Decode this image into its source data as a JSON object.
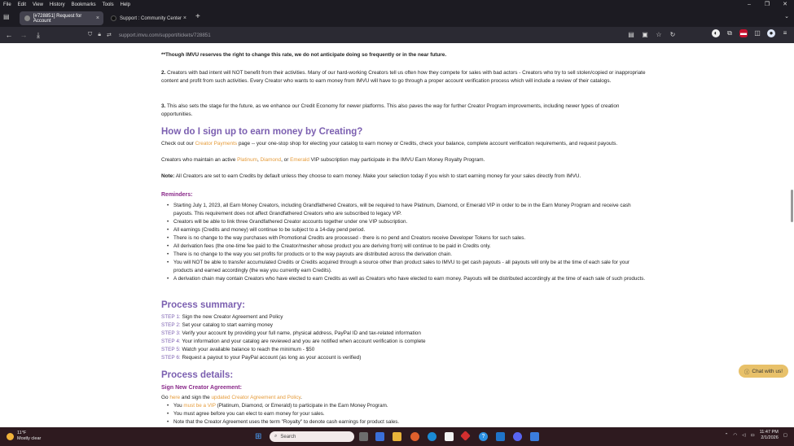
{
  "menubar": {
    "items": [
      "File",
      "Edit",
      "View",
      "History",
      "Bookmarks",
      "Tools",
      "Help"
    ]
  },
  "window_controls": {
    "minimize": "–",
    "maximize": "❐",
    "close": "✕"
  },
  "tabs": [
    {
      "label": "[#728851] Request for Account",
      "close": "×"
    },
    {
      "label": "Support : Community Center",
      "close": "×"
    }
  ],
  "new_tab": "+",
  "tab_overflow": "⌄",
  "navbar": {
    "back": "←",
    "forward": "→",
    "downloads": "⤓",
    "url": "support.imvu.com/support/tickets/728851"
  },
  "content": {
    "note_rate": "**Though IMVU reserves the right to change this rate, we do not anticipate doing so frequently or in the near future.",
    "point2_num": "2.",
    "point2_text": " Creators with bad intent will NOT benefit from their activities. Many of our hard-working Creators tell us often how they compete for sales with bad actors - Creators who try to sell stolen/copied or inappropriate content and profit from such activities. Every Creator who wants to earn money from IMVU will have to go through a proper account verification process which will include a review of their catalogs.",
    "point3_num": "3.",
    "point3_text": " This also sets the stage for the future, as we enhance our Credit Economy for newer platforms. This also paves the way for further Creator Program improvements, including newer types of creation opportunities.",
    "signup_heading": "How do I sign up to earn money by Creating?",
    "checkout_pre": "Check out our ",
    "checkout_link": "Creator Payments",
    "checkout_post": " page -- your one-stop shop for electing your catalog to earn money or Credits, check your balance, complete account verification requirements, and request payouts.",
    "vip_pre": "Creators who maintain an active ",
    "vip_platinum": "Platinum",
    "vip_sep1": ", ",
    "vip_diamond": "Diamond",
    "vip_sep2": ", or ",
    "vip_emerald": "Emerald",
    "vip_post": " VIP subscription may participate in the IMVU Earn Money Royalty Program.",
    "note_label": "Note:",
    "note_text": " All Creators are set to earn Credits by default unless they choose to earn money. Make your selection today if you wish to start earning money for your sales directly from IMVU.",
    "reminders_heading": "Reminders:",
    "reminders": [
      "Starting July 1, 2023, all Earn Money Creators, including Grandfathered Creators, will be required to have Platinum, Diamond, or Emerald VIP in order to be in the Earn Money Program and receive cash payouts. This requirement does not affect Grandfathered Creators who are subscribed to legacy VIP.",
      "Creators will be able to link three Grandfathered Creator accounts together under one VIP subscription.",
      "All earnings (Credits and money) will continue to be subject to a 14-day pend period.",
      "There is no change to the way purchases with Promotional Credits are processed - there is no pend and Creators receive Developer Tokens for such sales.",
      "All derivation fees (the one-time fee paid to the Creator/mesher whose product you are deriving from) will continue to be paid in Credits only.",
      "There is no change to the way you set profits for products or to the way payouts are distributed across the derivation chain.",
      "You will NOT be able to transfer accumulated Credits or Credits acquired through a source other than product sales to IMVU to get cash payouts - all payouts will only be at the time of each sale for your products and earned accordingly (the way you currently earn Credits).",
      "A derivation chain may contain Creators who have elected to earn Credits as well as Creators who have elected to earn money. Payouts will be distributed accordingly at the time of each sale of such products."
    ],
    "summary_heading": "Process summary:",
    "steps": [
      {
        "label": "STEP 1:",
        "text": " Sign the new Creator Agreement and Policy"
      },
      {
        "label": "STEP 2:",
        "text": " Set your catalog to start earning money"
      },
      {
        "label": "STEP 3:",
        "text": " Verify your account by providing your full name, physical address, PayPal ID and tax-related information"
      },
      {
        "label": "STEP 4:",
        "text": " Your information and your catalog are reviewed and you are notified when account verification is complete"
      },
      {
        "label": "STEP 5:",
        "text": " Watch your available balance to reach the minimum - $50"
      },
      {
        "label": "STEP 6:",
        "text": " Request a payout to your PayPal account (as long as your account is verified)"
      }
    ],
    "details_heading": "Process details:",
    "agreement_heading": "Sign New Creator Agreement:",
    "goto_pre": "Go ",
    "goto_here": "here",
    "goto_mid": " and sign the ",
    "goto_link": "updated Creator Agreement and Policy",
    "goto_post": ".",
    "detail_bullets": [
      {
        "pre": "You ",
        "link": "must be a VIP",
        "post": " (Platinum, Diamond, or Emerald) to participate in the Earn Money Program."
      },
      {
        "pre": "You must agree before you can elect to earn money for your sales.",
        "link": "",
        "post": ""
      },
      {
        "pre": "Note that the Creator Agreement uses the term \"Royalty\" to denote cash earnings for product sales.",
        "link": "",
        "post": ""
      }
    ]
  },
  "chat": {
    "label": "Chat with us!"
  },
  "taskbar": {
    "temp": "11°F",
    "condition": "Mostly clear",
    "search_placeholder": "Search",
    "time": "11:47 PM",
    "date": "2/1/2026"
  }
}
